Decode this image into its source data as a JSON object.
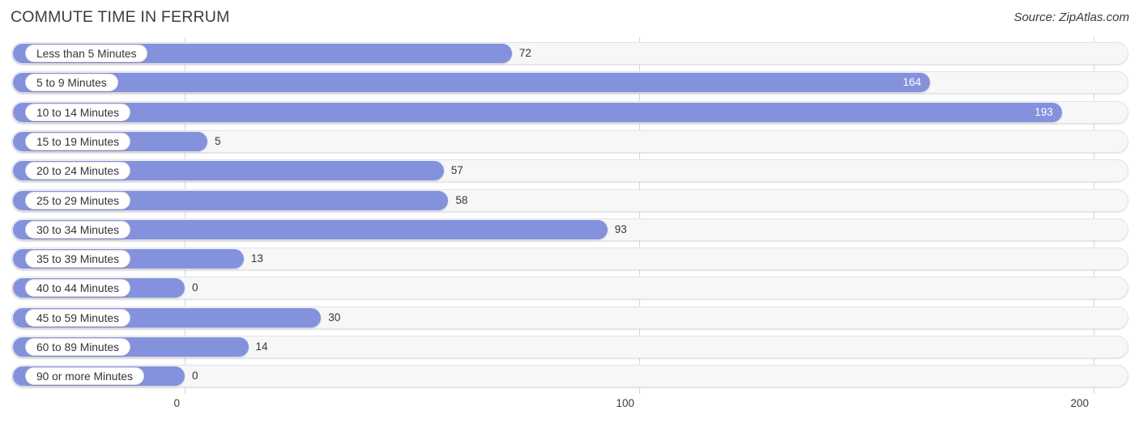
{
  "header": {
    "title": "COMMUTE TIME IN FERRUM",
    "source": "Source: ZipAtlas.com"
  },
  "axis": {
    "ticks": [
      "0",
      "100",
      "200"
    ]
  },
  "chart_data": {
    "type": "bar",
    "orientation": "horizontal",
    "title": "COMMUTE TIME IN FERRUM",
    "subtitle": "Source: ZipAtlas.com",
    "xlabel": "",
    "ylabel": "",
    "xlim": [
      0,
      200
    ],
    "xticks": [
      0,
      100,
      200
    ],
    "grid": true,
    "legend": null,
    "bar_color": "#8492de",
    "track_color": "#f7f7f8",
    "categories": [
      "Less than 5 Minutes",
      "5 to 9 Minutes",
      "10 to 14 Minutes",
      "15 to 19 Minutes",
      "20 to 24 Minutes",
      "25 to 29 Minutes",
      "30 to 34 Minutes",
      "35 to 39 Minutes",
      "40 to 44 Minutes",
      "45 to 59 Minutes",
      "60 to 89 Minutes",
      "90 or more Minutes"
    ],
    "values": [
      72,
      164,
      193,
      5,
      57,
      58,
      93,
      13,
      0,
      30,
      14,
      0
    ],
    "value_labels": [
      "72",
      "164",
      "193",
      "5",
      "57",
      "58",
      "93",
      "13",
      "0",
      "30",
      "14",
      "0"
    ]
  }
}
